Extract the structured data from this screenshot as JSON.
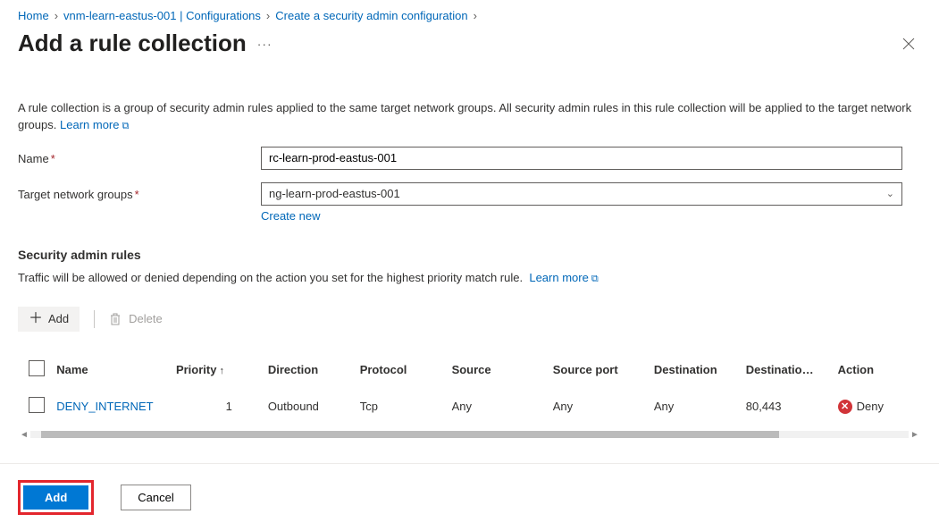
{
  "breadcrumb": {
    "home": "Home",
    "config": "vnm-learn-eastus-001 | Configurations",
    "create": "Create a security admin configuration"
  },
  "header": {
    "title": "Add a rule collection",
    "ellipsis": "···"
  },
  "desc": {
    "text": "A rule collection is a group of security admin rules applied to the same target network groups. All security admin rules in this rule collection will be applied to the target network groups.",
    "learn_more": "Learn more"
  },
  "form": {
    "name_label": "Name",
    "name_value": "rc-learn-prod-eastus-001",
    "tng_label": "Target network groups",
    "tng_value": "ng-learn-prod-eastus-001",
    "create_new": "Create new"
  },
  "rules_section": {
    "title": "Security admin rules",
    "subtitle": "Traffic will be allowed or denied depending on the action you set for the highest priority match rule.",
    "learn_more": "Learn more"
  },
  "toolbar": {
    "add_label": "Add",
    "delete_label": "Delete"
  },
  "columns": {
    "name": "Name",
    "priority": "Priority",
    "direction": "Direction",
    "protocol": "Protocol",
    "source": "Source",
    "source_port": "Source port",
    "destination": "Destination",
    "destination_port": "Destinatio…",
    "action": "Action"
  },
  "rows": [
    {
      "name": "DENY_INTERNET",
      "priority": "1",
      "direction": "Outbound",
      "protocol": "Tcp",
      "source": "Any",
      "source_port": "Any",
      "destination": "Any",
      "destination_port": "80,443",
      "action": "Deny"
    }
  ],
  "footer": {
    "add": "Add",
    "cancel": "Cancel"
  }
}
